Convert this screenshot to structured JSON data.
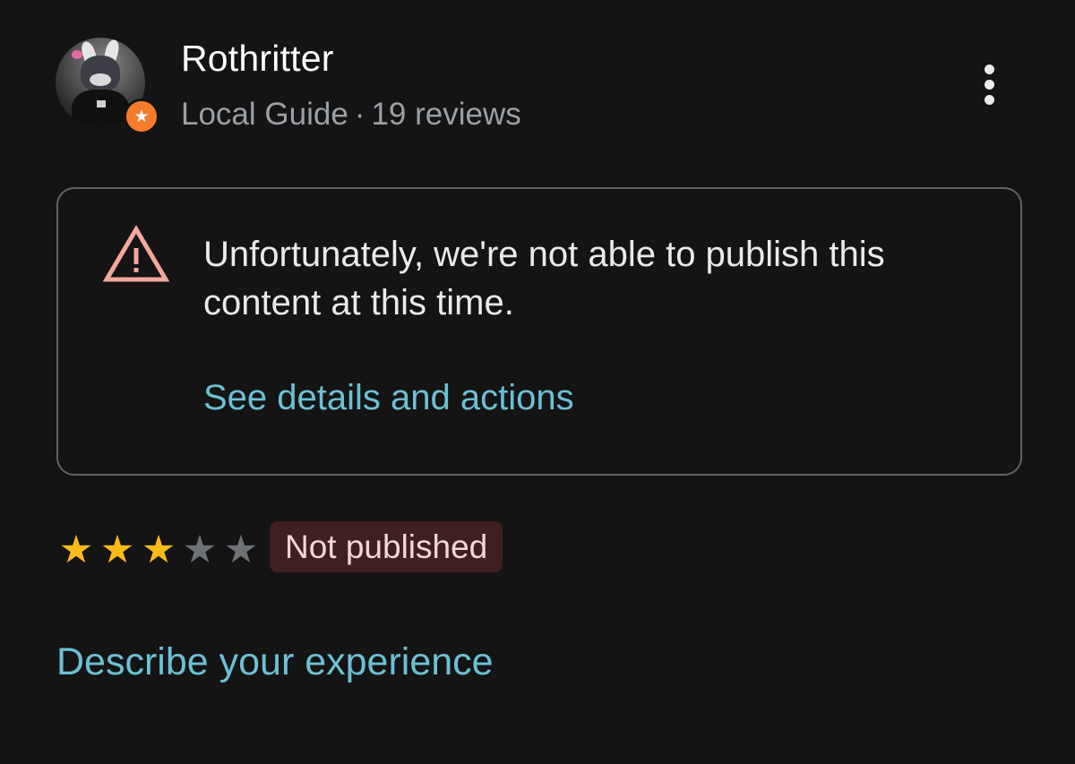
{
  "user": {
    "name": "Rothritter",
    "level": "Local Guide",
    "separator": "·",
    "reviews_count": "19 reviews",
    "avatar_icon": "user-avatar-photo",
    "badge_icon": "local-guide-star-icon",
    "badge_glyph": "★",
    "badge_color": "#f57c2b"
  },
  "menu": {
    "icon": "more-vert-icon"
  },
  "notice": {
    "icon": "warning-triangle-icon",
    "icon_color": "#f4a79d",
    "message": "Unfortunately, we're not able to publish this content at this time.",
    "action_label": "See details and actions"
  },
  "rating": {
    "value": 3,
    "max": 5,
    "star_glyph": "★",
    "filled_color": "#f9bb16",
    "empty_color": "#6e7175"
  },
  "status": {
    "label": "Not published",
    "background": "#3f1f1f"
  },
  "prompt": {
    "label": "Describe your experience"
  },
  "colors": {
    "background": "#141414",
    "link": "#6cc0d4",
    "secondary_text": "#9aa0a6"
  }
}
